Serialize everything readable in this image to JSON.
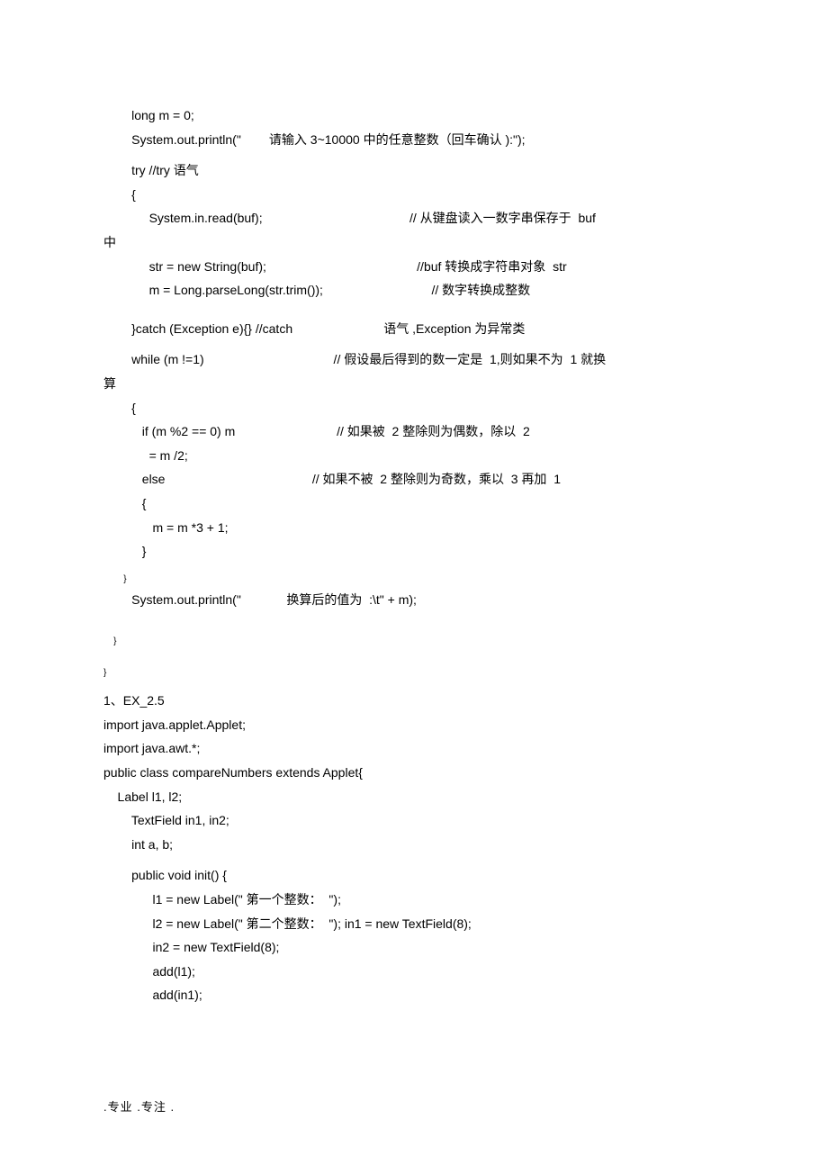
{
  "lines": {
    "l1": "        long m = 0;",
    "l2l": "        System.out.println(\"",
    "l2r": "        请输入 3~10000 中的任意整数（回车确认 ):\");",
    "l3": "        try //try 语气",
    "l4": "        {",
    "l5l": "             System.in.read(buf);",
    "l5r": "                                          // 从键盘读入一数字串保存于  buf",
    "l6": "中",
    "l7l": "             str = new String(buf);",
    "l7r": "                                           //buf 转换成字符串对象  str",
    "l8l": "             m = Long.parseLong(str.trim());",
    "l8r": "                               // 数字转换成整数",
    "l9l": "        }catch (Exception e){} //catch",
    "l9r": "                          语气 ,Exception 为异常类",
    "l10l": "        while (m !=1)",
    "l10r": "                                     // 假设最后得到的数一定是  1,则如果不为  1 就换",
    "l11": "算",
    "l12": "        {",
    "l13l": "           if (m %2 == 0) m",
    "l13r": "                             // 如果被  2 整除则为偶数，除以  2",
    "l14": "             = m /2;",
    "l15l": "           else",
    "l15r": "                                          // 如果不被  2 整除则为奇数，乘以  3 再加  1",
    "l16": "           {",
    "l17": "              m = m *3 + 1;",
    "l18": "           }",
    "l19": "        }",
    "l20l": "        System.out.println(\"",
    "l20r": "             换算后的值为  :\\t\" + m);",
    "l21": "    }",
    "l22": "}",
    "l23": "1、EX_2.5",
    "l24": "import java.applet.Applet;",
    "l25": "import java.awt.*;",
    "l26": "public class compareNumbers extends Applet{",
    "l27": "    Label l1, l2;",
    "l28": "        TextField in1, in2;",
    "l29": "        int a, b;",
    "l30": "        public void init() {",
    "l31": "              l1 = new Label(\" 第一个整数：  \");",
    "l32": "              l2 = new Label(\" 第二个整数：  \"); in1 = new TextField(8);",
    "l33": "              in2 = new TextField(8);",
    "l34": "              add(l1);",
    "l35": "              add(in1);"
  },
  "footer": ".专业  .专注  ."
}
